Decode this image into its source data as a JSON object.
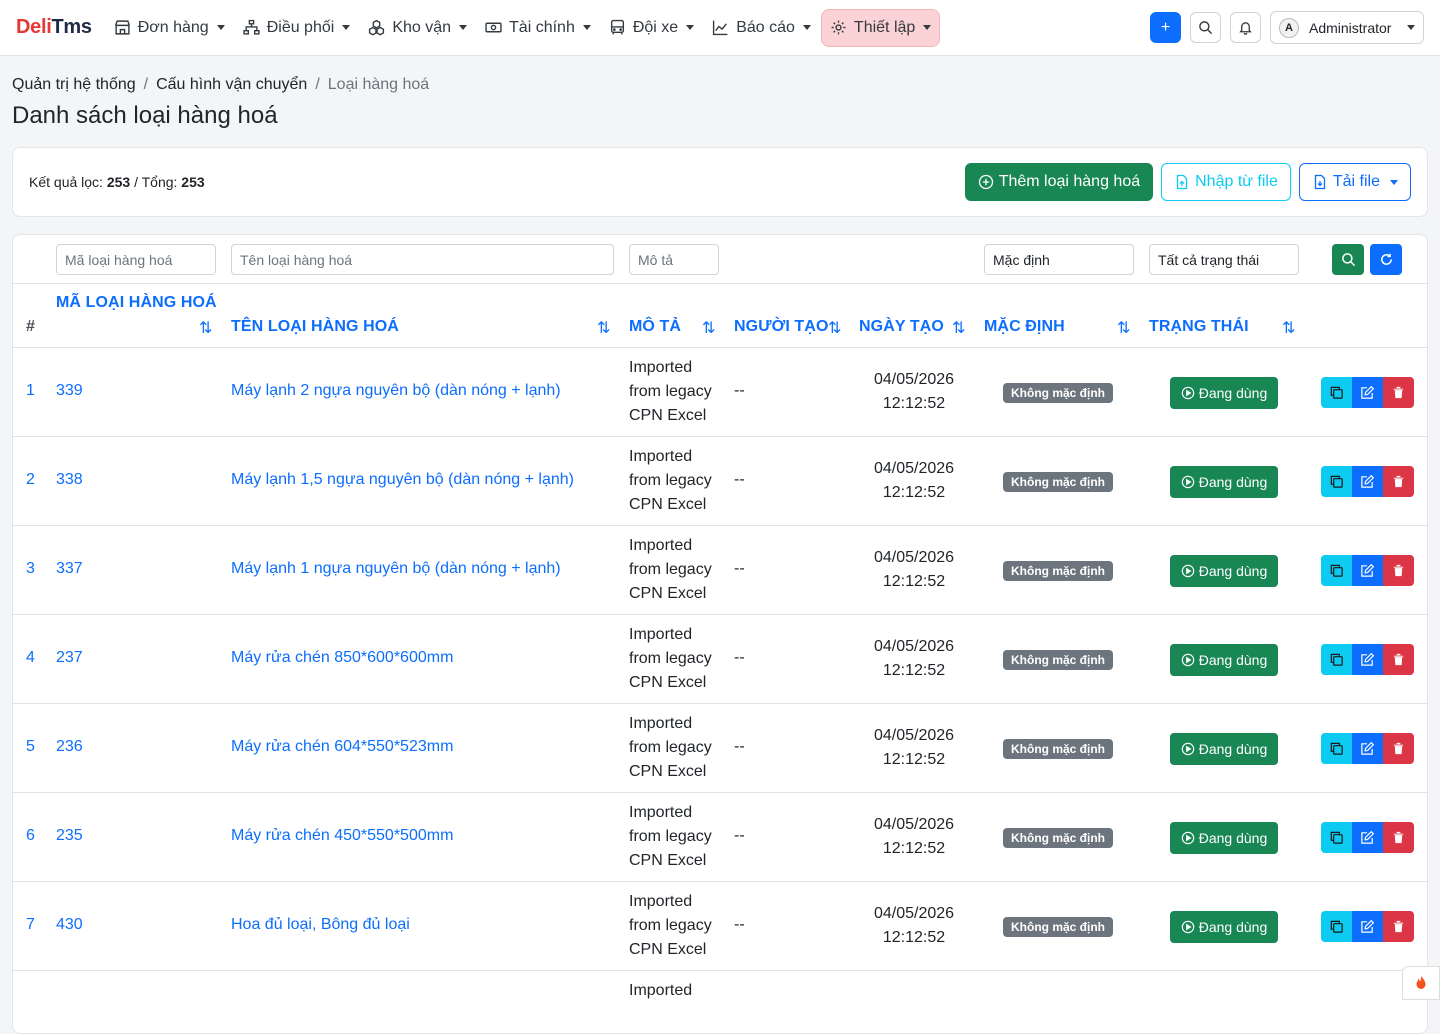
{
  "brand": {
    "part1": "Deli",
    "part2": "Tms"
  },
  "nav": [
    {
      "label": "Đơn hàng",
      "icon": "store-icon"
    },
    {
      "label": "Điều phối",
      "icon": "network-icon"
    },
    {
      "label": "Kho vận",
      "icon": "boxes-icon"
    },
    {
      "label": "Tài chính",
      "icon": "cash-icon"
    },
    {
      "label": "Đội xe",
      "icon": "bus-icon"
    },
    {
      "label": "Báo cáo",
      "icon": "chart-icon"
    },
    {
      "label": "Thiết lập",
      "icon": "gear-icon",
      "active": true
    }
  ],
  "user": {
    "initial": "A",
    "name": "Administrator"
  },
  "breadcrumb": [
    "Quản trị hệ thống",
    "Cấu hình vận chuyển",
    "Loại hàng hoá"
  ],
  "page_title": "Danh sách loại hàng hoá",
  "toolbar": {
    "result_label": "Kết quả lọc:",
    "result_count": "253",
    "total_label": "/ Tổng:",
    "total_count": "253",
    "add_button": "Thêm loại hàng hoá",
    "import_button": "Nhập từ file",
    "download_button": "Tải file"
  },
  "filters": {
    "code_placeholder": "Mã loại hàng hoá",
    "name_placeholder": "Tên loại hàng hoá",
    "desc_placeholder": "Mô tả",
    "default_value": "Mặc định",
    "status_value": "Tất cả trạng thái"
  },
  "columns": {
    "index": "#",
    "code": "Mã loại hàng hoá",
    "name": "Tên loại hàng hoá",
    "desc": "Mô tả",
    "creator": "Người tạo",
    "created": "Ngày tạo",
    "default": "Mặc định",
    "status": "Trạng thái"
  },
  "rows": [
    {
      "idx": "1",
      "code": "339",
      "name": "Máy lạnh 2 ngựa nguyên bộ (dàn nóng + lạnh)",
      "desc1": "Imported",
      "desc2": "from legacy",
      "desc3": "CPN Excel",
      "creator": "--",
      "date": "04/05/2026",
      "time": "12:12:52",
      "default": "Không mặc định",
      "status": "Đang dùng"
    },
    {
      "idx": "2",
      "code": "338",
      "name": "Máy lạnh 1,5 ngựa nguyên bộ (dàn nóng + lạnh)",
      "desc1": "Imported",
      "desc2": "from legacy",
      "desc3": "CPN Excel",
      "creator": "--",
      "date": "04/05/2026",
      "time": "12:12:52",
      "default": "Không mặc định",
      "status": "Đang dùng"
    },
    {
      "idx": "3",
      "code": "337",
      "name": "Máy lạnh 1 ngựa nguyên bộ (dàn nóng + lạnh)",
      "desc1": "Imported",
      "desc2": "from legacy",
      "desc3": "CPN Excel",
      "creator": "--",
      "date": "04/05/2026",
      "time": "12:12:52",
      "default": "Không mặc định",
      "status": "Đang dùng"
    },
    {
      "idx": "4",
      "code": "237",
      "name": "Máy rửa chén 850*600*600mm",
      "desc1": "Imported",
      "desc2": "from legacy",
      "desc3": "CPN Excel",
      "creator": "--",
      "date": "04/05/2026",
      "time": "12:12:52",
      "default": "Không mặc định",
      "status": "Đang dùng"
    },
    {
      "idx": "5",
      "code": "236",
      "name": "Máy rửa chén 604*550*523mm",
      "desc1": "Imported",
      "desc2": "from legacy",
      "desc3": "CPN Excel",
      "creator": "--",
      "date": "04/05/2026",
      "time": "12:12:52",
      "default": "Không mặc định",
      "status": "Đang dùng"
    },
    {
      "idx": "6",
      "code": "235",
      "name": "Máy rửa chén 450*550*500mm",
      "desc1": "Imported",
      "desc2": "from legacy",
      "desc3": "CPN Excel",
      "creator": "--",
      "date": "04/05/2026",
      "time": "12:12:52",
      "default": "Không mặc định",
      "status": "Đang dùng"
    },
    {
      "idx": "7",
      "code": "430",
      "name": "Hoa đủ loại, Bông đủ loại",
      "desc1": "Imported",
      "desc2": "from legacy",
      "desc3": "CPN Excel",
      "creator": "--",
      "date": "04/05/2026",
      "time": "12:12:52",
      "default": "Không mặc định",
      "status": "Đang dùng"
    }
  ],
  "partial_row": {
    "desc1": "Imported"
  },
  "colors": {
    "primary": "#0d6efd",
    "success": "#198754",
    "danger": "#dc3545",
    "info": "#0dcaf0",
    "secondary": "#6c757d",
    "brand_red": "#e53935"
  }
}
